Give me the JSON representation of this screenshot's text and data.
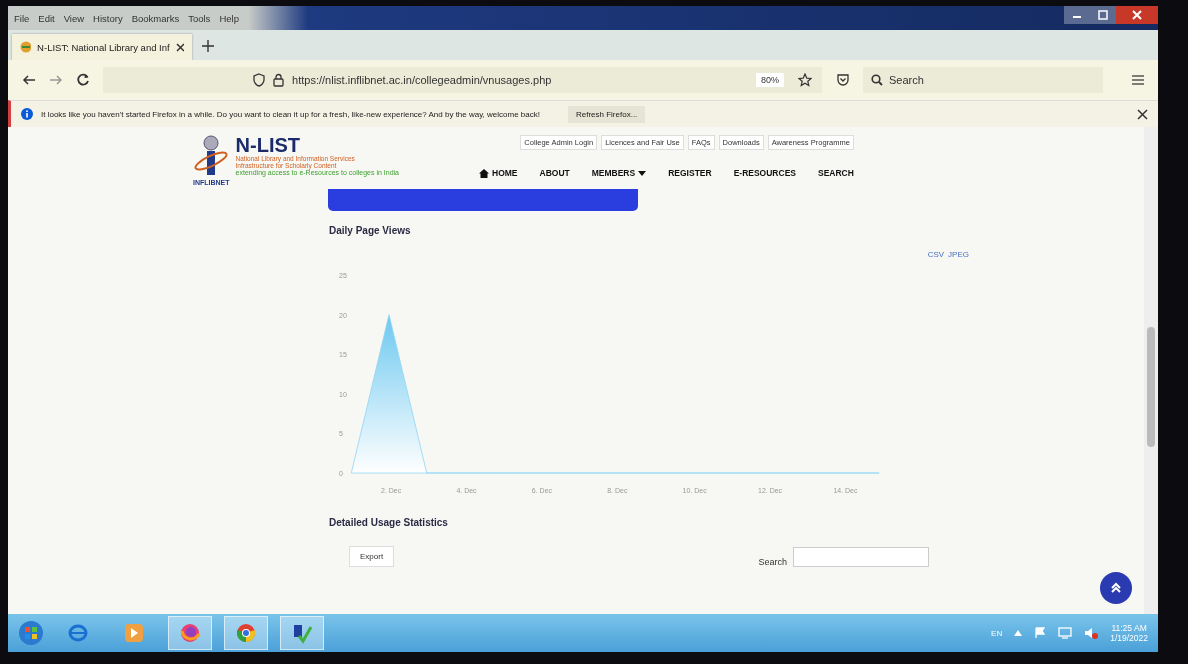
{
  "menu_bar": [
    "File",
    "Edit",
    "View",
    "History",
    "Bookmarks",
    "Tools",
    "Help"
  ],
  "tabs": [
    {
      "label": "N-LIST: National Library and Inf",
      "selected": true
    }
  ],
  "toolbar": {
    "url": "https://nlist.inflibnet.ac.in/collegeadmin/vnusages.php",
    "zoom": "80%",
    "search_placeholder": "Search"
  },
  "notification": {
    "message": "It looks like you haven't started Firefox in a while. Do you want to clean it up for a fresh, like-new experience? And by the way, welcome back!",
    "button": "Refresh Firefox..."
  },
  "site": {
    "logo_caption": "INFLIBNET",
    "title": "N-LIST",
    "subtitle_lines": [
      "National Library and Information Services",
      "Infrastructure for Scholarly Content"
    ],
    "tagline": "extending access to e-Resources to colleges in India",
    "top_links": [
      "College Admin Login",
      "Licences and Fair Use",
      "FAQs",
      "Downloads",
      "Awareness Programme"
    ],
    "nav": [
      {
        "label": "HOME",
        "kind": "home"
      },
      {
        "label": "ABOUT",
        "kind": "plain"
      },
      {
        "label": "MEMBERS",
        "kind": "dropdown"
      },
      {
        "label": "REGISTER",
        "kind": "plain"
      },
      {
        "label": "E-RESOURCES",
        "kind": "plain"
      },
      {
        "label": "SEARCH",
        "kind": "plain"
      }
    ]
  },
  "daily_views": {
    "title": "Daily Page Views",
    "export_links": [
      "CSV",
      "JPEG"
    ],
    "chart_data": {
      "type": "area",
      "categories": [
        null,
        "2. Dec",
        null,
        "4. Dec",
        null,
        "6. Dec",
        null,
        "8. Dec",
        null,
        "10. Dec",
        null,
        "12. Dec",
        null,
        "14. Dec",
        null
      ],
      "values": [
        0,
        20,
        0,
        0,
        0,
        0,
        0,
        0,
        0,
        0,
        0,
        0,
        0,
        0,
        0
      ],
      "ylim": [
        0,
        25
      ],
      "yticks": [
        0,
        5,
        10,
        15,
        20,
        25
      ]
    }
  },
  "usage": {
    "title": "Detailed Usage Statistics",
    "export_button": "Export",
    "search_label": "Search"
  },
  "taskbar": {
    "language": "EN",
    "time": "11:25 AM",
    "date": "1/19/2022"
  }
}
